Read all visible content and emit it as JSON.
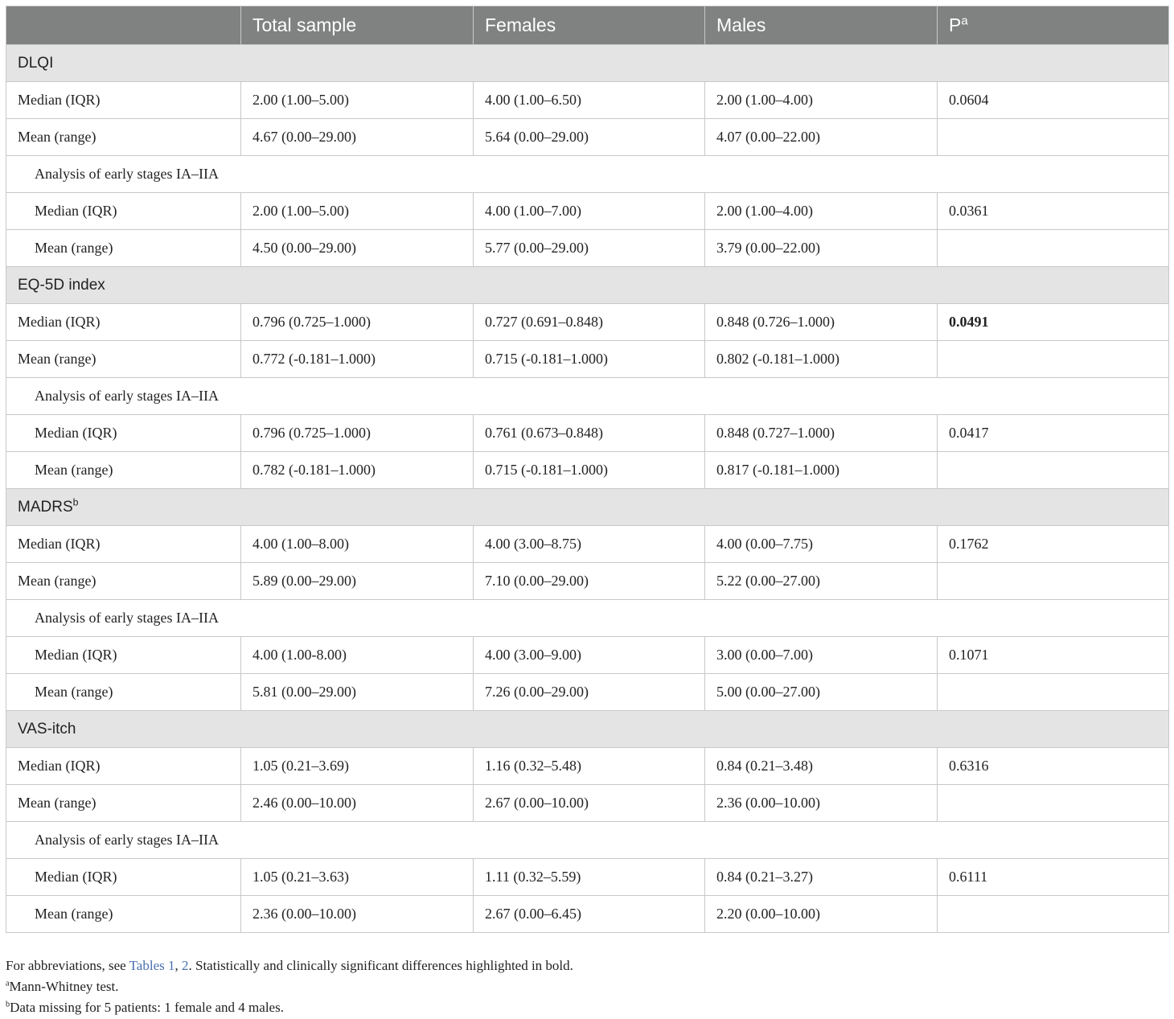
{
  "table": {
    "headers": [
      "",
      "Total sample",
      "Females",
      "Males",
      "P"
    ],
    "p_superscript": "a",
    "sections": [
      {
        "label": "DLQI",
        "superscript": "",
        "rows": [
          {
            "label": "Median (IQR)",
            "cells": [
              "2.00 (1.00–5.00)",
              "4.00 (1.00–6.50)",
              "2.00 (1.00–4.00)",
              "0.0604"
            ],
            "indent": false
          },
          {
            "label": "Mean (range)",
            "cells": [
              "4.67 (0.00–29.00)",
              "5.64 (0.00–29.00)",
              "4.07 (0.00–22.00)",
              ""
            ],
            "indent": false
          },
          {
            "label": "Analysis of early stages IA–IIA",
            "subheading": true
          },
          {
            "label": "Median (IQR)",
            "cells": [
              "2.00 (1.00–5.00)",
              "4.00 (1.00–7.00)",
              "2.00 (1.00–4.00)",
              "0.0361"
            ],
            "indent": true
          },
          {
            "label": "Mean (range)",
            "cells": [
              "4.50 (0.00–29.00)",
              "5.77 (0.00–29.00)",
              "3.79 (0.00–22.00)",
              ""
            ],
            "indent": true
          }
        ]
      },
      {
        "label": "EQ-5D index",
        "superscript": "",
        "rows": [
          {
            "label": "Median (IQR)",
            "cells": [
              "0.796 (0.725–1.000)",
              "0.727 (0.691–0.848)",
              "0.848 (0.726–1.000)",
              "0.0491"
            ],
            "indent": false,
            "bold_p": true
          },
          {
            "label": "Mean (range)",
            "cells": [
              "0.772 (-0.181–1.000)",
              "0.715 (-0.181–1.000)",
              "0.802 (-0.181–1.000)",
              ""
            ],
            "indent": false
          },
          {
            "label": "Analysis of early stages IA–IIA",
            "subheading": true
          },
          {
            "label": "Median (IQR)",
            "cells": [
              "0.796 (0.725–1.000)",
              "0.761 (0.673–0.848)",
              "0.848 (0.727–1.000)",
              "0.0417"
            ],
            "indent": true
          },
          {
            "label": "Mean (range)",
            "cells": [
              "0.782 (-0.181–1.000)",
              "0.715 (-0.181–1.000)",
              "0.817 (-0.181–1.000)",
              ""
            ],
            "indent": true
          }
        ]
      },
      {
        "label": "MADRS",
        "superscript": "b",
        "rows": [
          {
            "label": "Median (IQR)",
            "cells": [
              "4.00 (1.00–8.00)",
              "4.00 (3.00–8.75)",
              "4.00 (0.00–7.75)",
              "0.1762"
            ],
            "indent": false
          },
          {
            "label": "Mean (range)",
            "cells": [
              "5.89 (0.00–29.00)",
              "7.10 (0.00–29.00)",
              "5.22 (0.00–27.00)",
              ""
            ],
            "indent": false
          },
          {
            "label": "Analysis of early stages IA–IIA",
            "subheading": true
          },
          {
            "label": "Median (IQR)",
            "cells": [
              "4.00 (1.00-8.00)",
              "4.00 (3.00–9.00)",
              "3.00 (0.00–7.00)",
              "0.1071"
            ],
            "indent": true
          },
          {
            "label": "Mean (range)",
            "cells": [
              "5.81 (0.00–29.00)",
              "7.26 (0.00–29.00)",
              "5.00 (0.00–27.00)",
              ""
            ],
            "indent": true
          }
        ]
      },
      {
        "label": "VAS-itch",
        "superscript": "",
        "rows": [
          {
            "label": "Median (IQR)",
            "cells": [
              "1.05 (0.21–3.69)",
              "1.16 (0.32–5.48)",
              "0.84 (0.21–3.48)",
              "0.6316"
            ],
            "indent": false
          },
          {
            "label": "Mean (range)",
            "cells": [
              "2.46 (0.00–10.00)",
              "2.67 (0.00–10.00)",
              "2.36 (0.00–10.00)",
              ""
            ],
            "indent": false
          },
          {
            "label": "Analysis of early stages IA–IIA",
            "subheading": true
          },
          {
            "label": "Median (IQR)",
            "cells": [
              "1.05 (0.21–3.63)",
              "1.11 (0.32–5.59)",
              "0.84 (0.21–3.27)",
              "0.6111"
            ],
            "indent": true
          },
          {
            "label": "Mean (range)",
            "cells": [
              "2.36 (0.00–10.00)",
              "2.67 (0.00–6.45)",
              "2.20 (0.00–10.00)",
              ""
            ],
            "indent": true
          }
        ]
      }
    ]
  },
  "footnotes": {
    "abbrev_prefix": "For abbreviations, see ",
    "abbrev_link_1": "Tables 1",
    "abbrev_sep": ", ",
    "abbrev_link_2": "2",
    "abbrev_suffix": ". Statistically and clinically significant differences highlighted in bold.",
    "note_a_mark": "a",
    "note_a_text": "Mann-Whitney test.",
    "note_b_mark": "b",
    "note_b_text": "Data missing for 5 patients: 1 female and 4 males."
  },
  "colors": {
    "header_bg": "#7f8281",
    "section_bg": "#e4e4e4",
    "link": "#4a6fb0",
    "border": "#c8c8c8"
  }
}
